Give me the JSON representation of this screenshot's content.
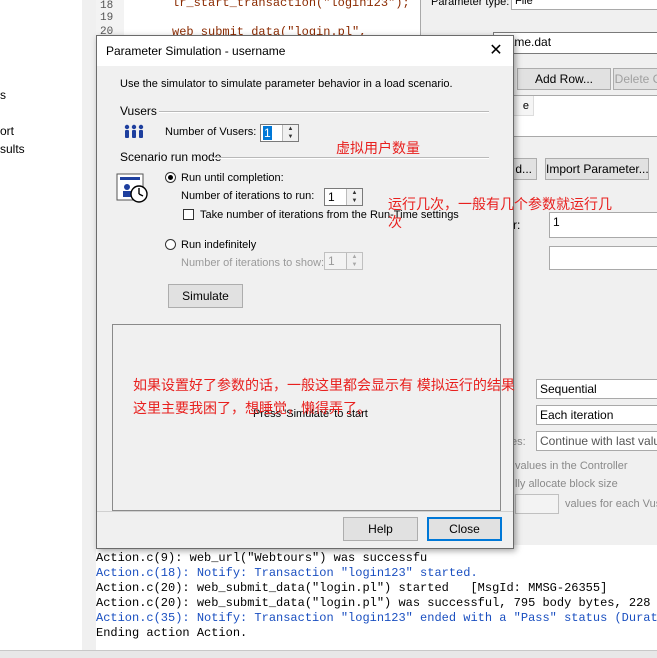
{
  "background": {
    "left_pane": [
      "s",
      "ort",
      "sults"
    ],
    "line_numbers": [
      "18",
      "19",
      "20"
    ],
    "code_lines": [
      "lr_start_transaction(\"login123\");",
      "web_submit_data(\"login.pl\","
    ],
    "right_panel": {
      "param_type_label": "Parameter type:",
      "param_type_value": "File",
      "file_value": "rname.dat",
      "add_row": "Add Row...",
      "delete": "Delete C",
      "col_header": "e",
      "edit_btn": "d...",
      "import_btn": "Import Parameter...",
      "col_label": "r:",
      "col_value": "1",
      "select_next": "Sequential",
      "update_value": "Each iteration",
      "when_out": "Continue with last value",
      "when_out_label": "es:",
      "controller_text": "values in the Controller",
      "alloc_text": "lly allocate block size",
      "vuser_text": "values for each Vus"
    },
    "output": [
      {
        "text": "Action.c(9): web_url(\"Webtours\") was successfu",
        "color": "black"
      },
      {
        "text": "Action.c(18): Notify: Transaction \"login123\" started.",
        "color": "blue"
      },
      {
        "text": "Action.c(20): web_submit_data(\"login.pl\") started   [MsgId: MMSG-26355]",
        "color": "black"
      },
      {
        "text": "Action.c(20): web_submit_data(\"login.pl\") was successful, 795 body bytes, 228 hea",
        "color": "black"
      },
      {
        "text": "Action.c(35): Notify: Transaction \"login123\" ended with a \"Pass\" status (Duration",
        "color": "blue"
      },
      {
        "text": "Ending action Action.",
        "color": "black"
      }
    ]
  },
  "dialog": {
    "title": "Parameter Simulation - username",
    "close_symbol": "✕",
    "intro": "Use the simulator to simulate parameter behavior in a load scenario.",
    "vusers_group": "Vusers",
    "vusers_label": "Number of Vusers:",
    "vusers_value": "1",
    "scenario_group": "Scenario run mode",
    "run_until": "Run until completion:",
    "iterations_label": "Number of iterations to run:",
    "iterations_value": "1",
    "take_number": "Take number of iterations from the Run-Time settings",
    "run_indef": "Run indefinitely",
    "iterations_show_label": "Number of iterations to show:",
    "iterations_show_value": "1",
    "simulate_btn": "Simulate",
    "result_text": "Press 'Simulate' to start",
    "help_btn": "Help",
    "close_btn": "Close"
  },
  "annotations": {
    "vusers_note": "虚拟用户数量",
    "iterations_note_1": "运行几次，一般有几个参数就运行几",
    "iterations_note_2": "次",
    "result_note_1": "如果设置好了参数的话，一般这里都会显示有 模拟运行的结果",
    "result_note_2": "这里主要我困了，想睡觉，懒得弄了。"
  },
  "colors": {
    "annotation": "#e8201e",
    "dialog_bg": "#f0f0f0",
    "output_blue": "#1a4fc0"
  }
}
